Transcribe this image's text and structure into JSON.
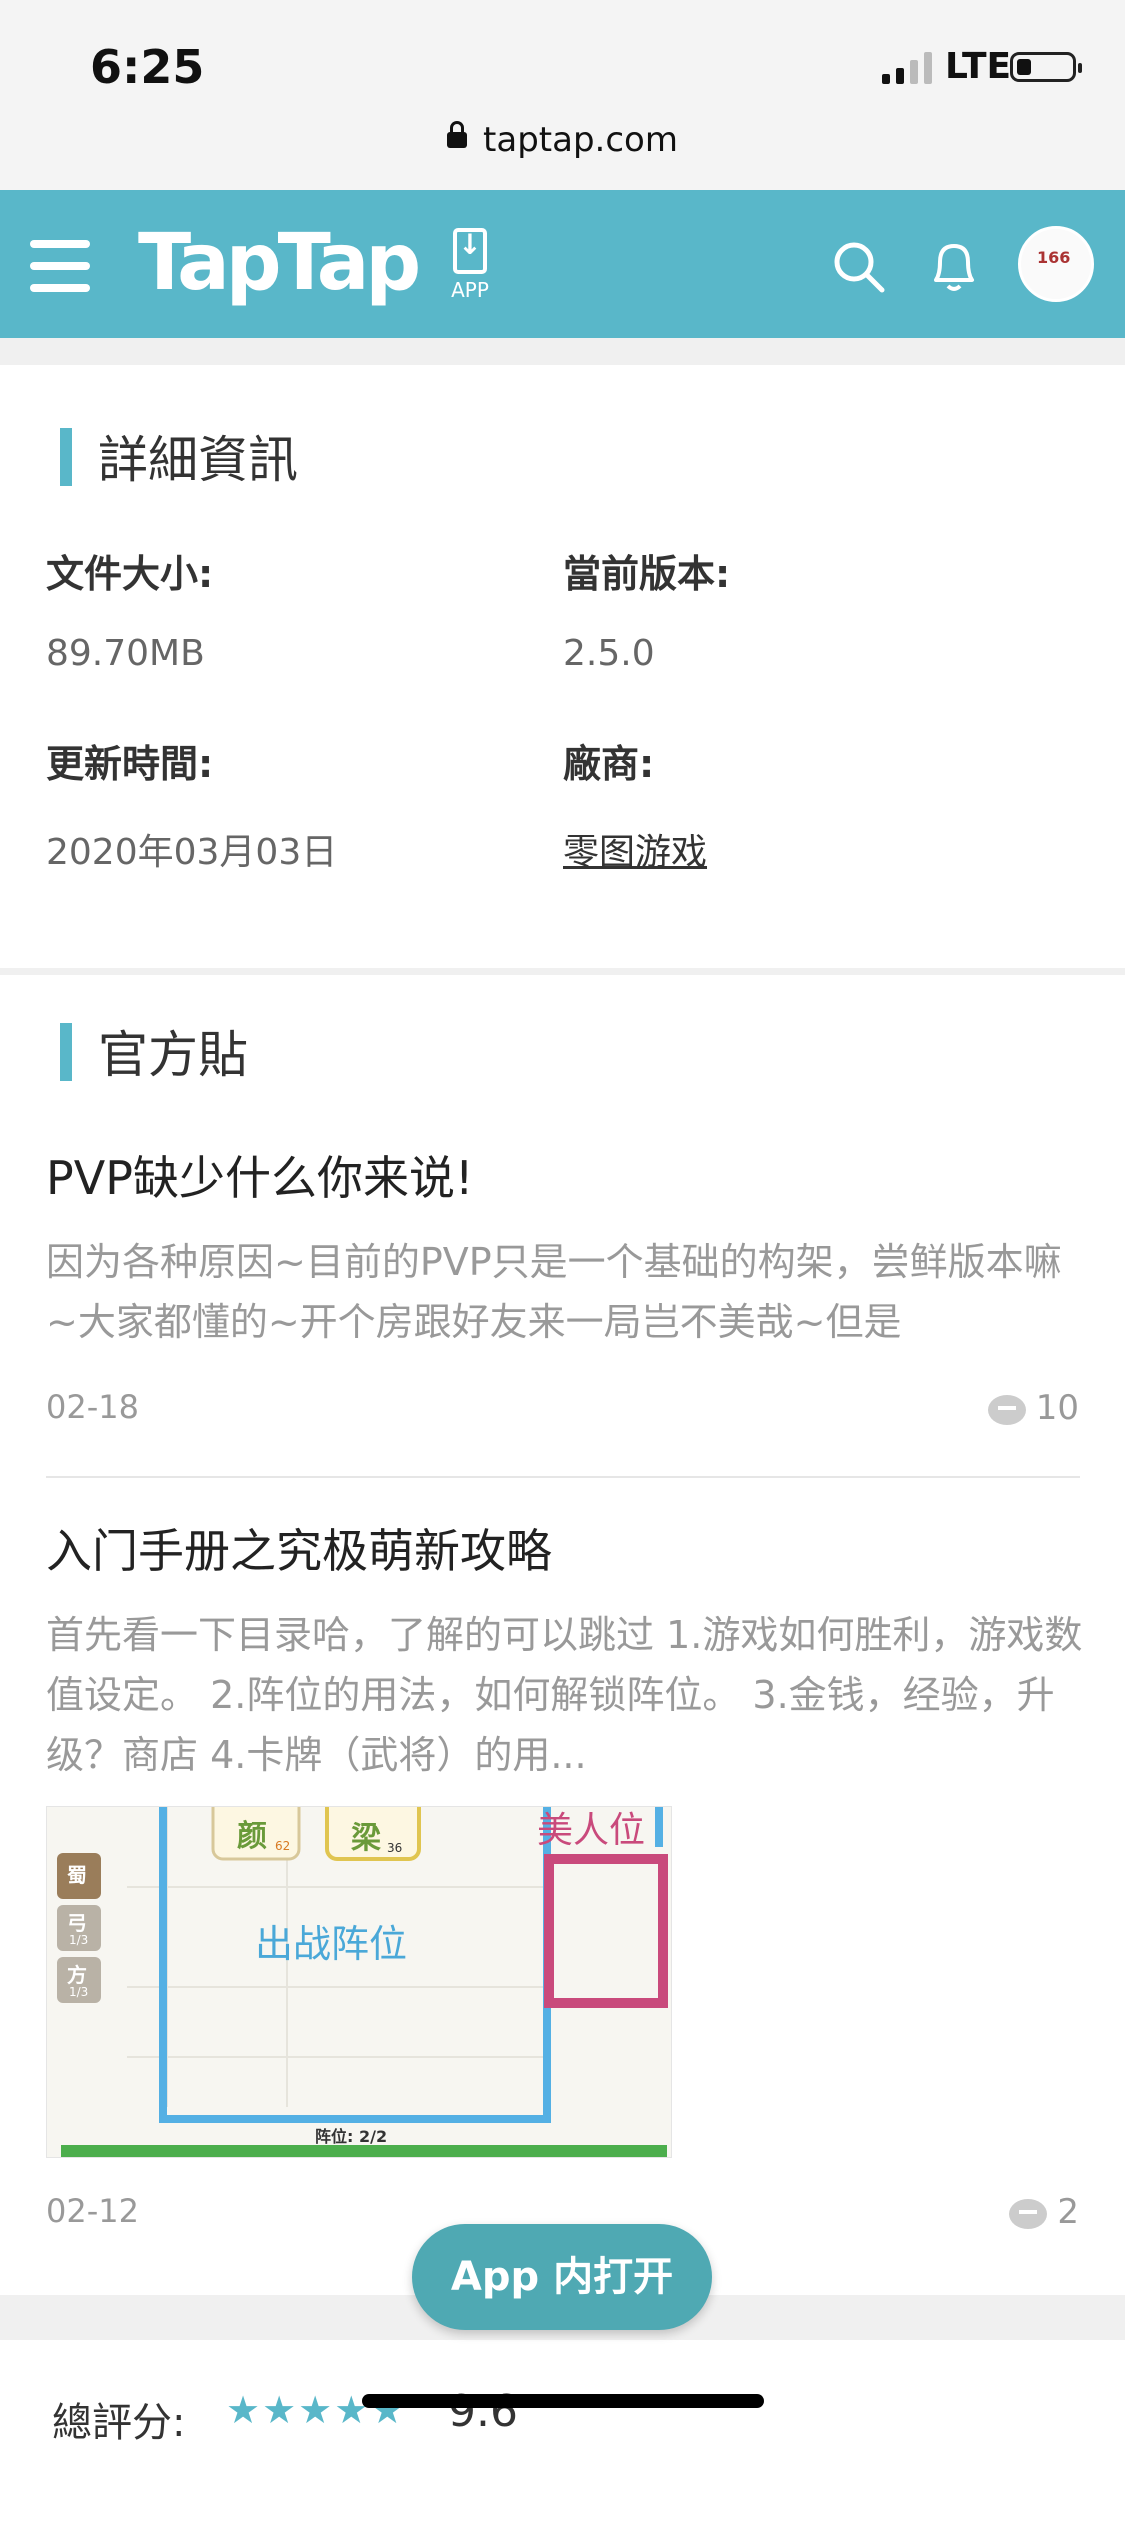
{
  "status": {
    "time": "6:25",
    "carrier": "LTE"
  },
  "browser": {
    "url": "taptap.com"
  },
  "header": {
    "logo": "TapTap",
    "app_label": "APP",
    "avatar_text": "166"
  },
  "details": {
    "section_title": "詳細資訊",
    "file_size_label": "文件大小:",
    "file_size_value": "89.70MB",
    "version_label": "當前版本:",
    "version_value": "2.5.0",
    "update_label": "更新時間:",
    "update_value": "2020年03月03日",
    "vendor_label": "廠商:",
    "vendor_value": "零图游戏"
  },
  "official": {
    "section_title": "官方貼",
    "posts": [
      {
        "title": "PVP缺少什么你来说!",
        "excerpt": "因为各种原因~目前的PVP只是一个基础的构架，尝鲜版本嘛~大家都懂的~开个房跟好友来一局岂不美哉~但是",
        "date": "02-18",
        "comments": "10"
      },
      {
        "title": "入门手册之究极萌新攻略",
        "excerpt": "首先看一下目录哈，了解的可以跳过 1.游戏如何胜利，游戏数值设定。 2.阵位的用法，如何解锁阵位。 3.金钱，经验，升级？商店 4.卡牌（武将）的用...",
        "date": "02-12",
        "comments": "2",
        "image": {
          "card1_name": "颜",
          "card1_num": "62",
          "card2_name": "梁",
          "card2_num": "36",
          "side1": "蜀",
          "side2": "弓",
          "side2_sub": "1/3",
          "side3": "方",
          "side3_sub": "1/3",
          "zone_label": "出战阵位",
          "beauty_label": "美人位",
          "bottom_label": "阵位: 2/2"
        }
      }
    ]
  },
  "open_app_button": "App 内打开",
  "rating": {
    "label": "總評分:",
    "stars": "★★★★★",
    "score": "9.6"
  }
}
